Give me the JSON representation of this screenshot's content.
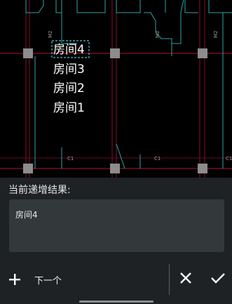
{
  "canvas": {
    "room_labels": [
      "房间4",
      "房间3",
      "房间2",
      "房间1"
    ],
    "axis_tags": [
      "M2",
      "M2",
      "M2",
      "C1",
      "C1",
      "C1"
    ]
  },
  "panel": {
    "title": "当前递增结果:",
    "result_value": "房间4"
  },
  "toolbar": {
    "next_label": "下一个",
    "add_icon": "plus-icon",
    "cancel_icon": "close-icon",
    "confirm_icon": "check-icon"
  },
  "colors": {
    "background": "#000000",
    "panel_bg": "#1f2224",
    "input_bg": "#33383b",
    "grid_line_red": "#b0123a",
    "grid_line_teal": "#2aa6a6",
    "column_grey": "#8c8c8c",
    "selection_dashed": "#3fc6d0"
  }
}
